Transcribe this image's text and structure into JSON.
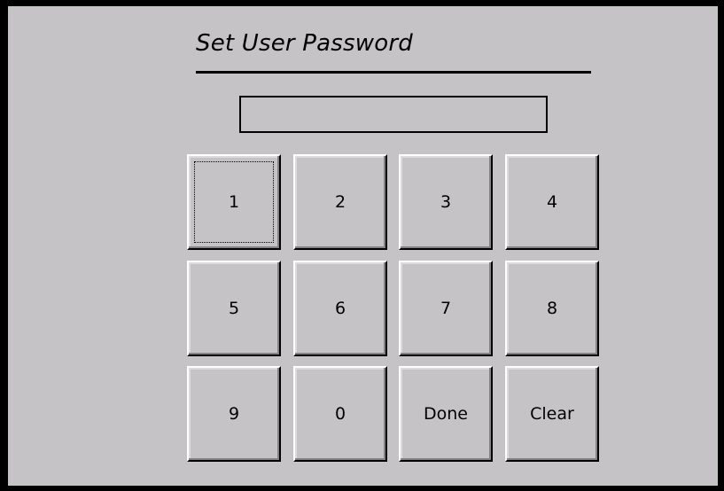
{
  "dialog": {
    "title": "Set User Password"
  },
  "password_field": {
    "value": ""
  },
  "keypad": {
    "focused_key": "1",
    "rows": [
      [
        "1",
        "2",
        "3",
        "4"
      ],
      [
        "5",
        "6",
        "7",
        "8"
      ],
      [
        "9",
        "0",
        "Done",
        "Clear"
      ]
    ]
  },
  "colors": {
    "background": "#c6c3c6",
    "frame": "#000000"
  }
}
